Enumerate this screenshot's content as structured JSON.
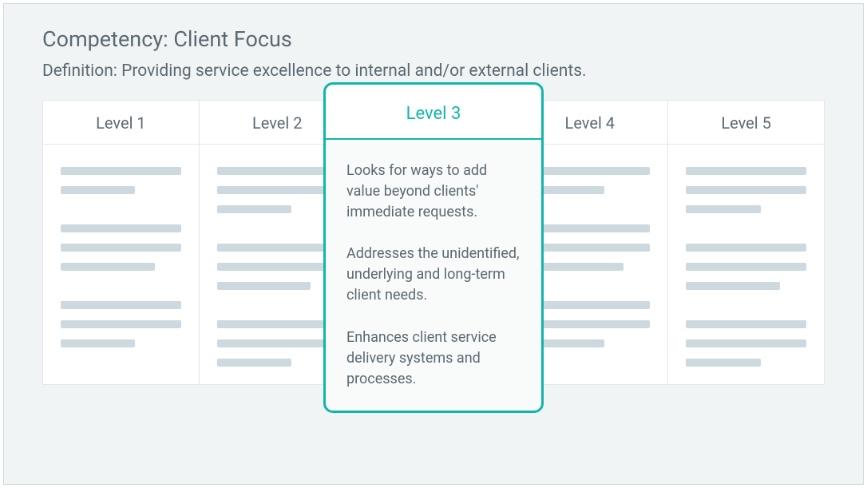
{
  "title": "Competency: Client Focus",
  "definition": "Definition: Providing service excellence to internal and/or external clients.",
  "levels": {
    "l1": {
      "label": "Level 1"
    },
    "l2": {
      "label": "Level 2"
    },
    "l3": {
      "label": "Level 3"
    },
    "l4": {
      "label": "Level 4"
    },
    "l5": {
      "label": "Level 5"
    }
  },
  "highlighted": {
    "label": "Level 3",
    "paragraphs": {
      "p1": "Looks for ways to add value beyond clients' immediate requests.",
      "p2": "Addresses the unidentified, underlying and long-term client needs.",
      "p3": "Enhances client service delivery systems and processes."
    }
  }
}
